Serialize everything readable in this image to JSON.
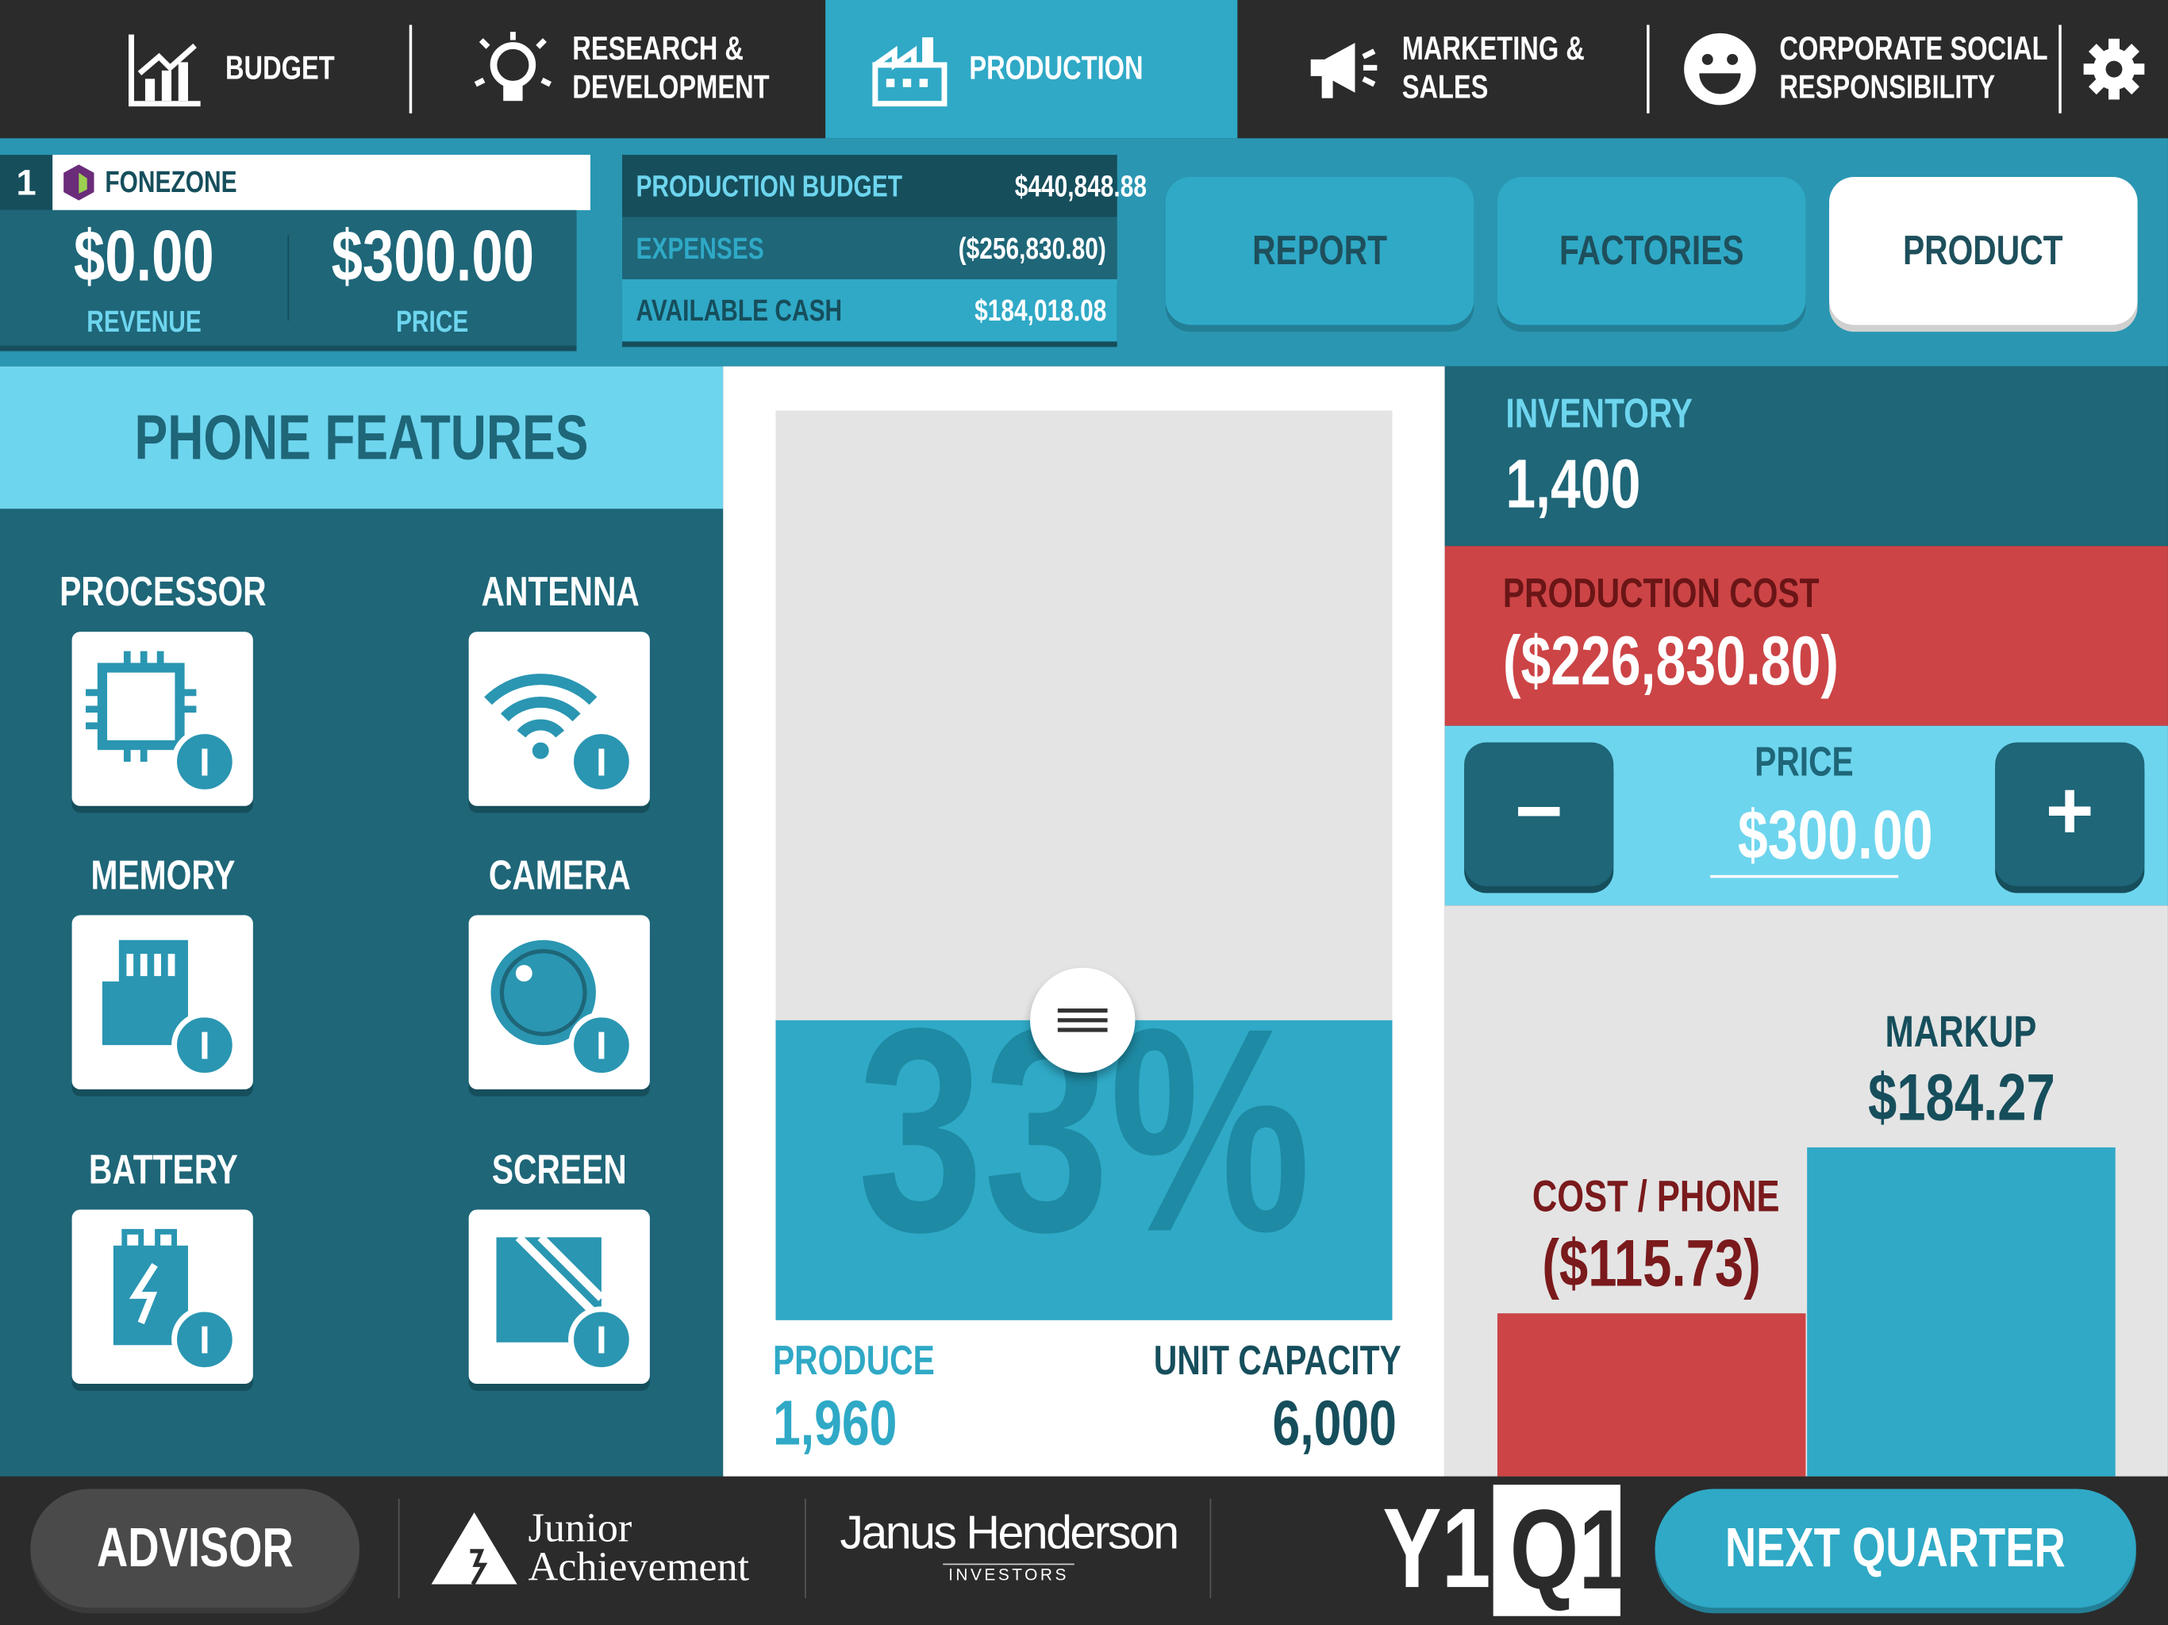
{
  "nav": {
    "tabs": [
      {
        "label_1": "BUDGET",
        "label_2": "",
        "icon": "chart-growth-icon"
      },
      {
        "label_1": "RESEARCH &",
        "label_2": "DEVELOPMENT",
        "icon": "lightbulb-icon"
      },
      {
        "label_1": "PRODUCTION",
        "label_2": "",
        "icon": "factory-icon",
        "active": true
      },
      {
        "label_1": "MARKETING &",
        "label_2": "SALES",
        "icon": "megaphone-icon"
      },
      {
        "label_1": "CORPORATE SOCIAL",
        "label_2": "RESPONSIBILITY",
        "icon": "smiley-icon"
      }
    ],
    "settings_icon": "gear-icon"
  },
  "company": {
    "rank": "1",
    "name": "FONEZONE",
    "revenue": "$0.00",
    "revenue_label": "REVENUE",
    "price": "$300.00",
    "price_label": "PRICE"
  },
  "budget": {
    "rows": [
      {
        "label": "PRODUCTION BUDGET",
        "value": "$440,848.88"
      },
      {
        "label": "EXPENSES",
        "value": "($256,830.80)"
      },
      {
        "label": "AVAILABLE CASH",
        "value": "$184,018.08"
      }
    ]
  },
  "views": {
    "report": "REPORT",
    "factories": "FACTORIES",
    "product": "PRODUCT",
    "selected": "PRODUCT"
  },
  "features": {
    "title": "PHONE FEATURES",
    "items": [
      {
        "label": "PROCESSOR",
        "icon": "processor-chip-icon",
        "level": "I"
      },
      {
        "label": "ANTENNA",
        "icon": "wifi-antenna-icon",
        "level": "I"
      },
      {
        "label": "MEMORY",
        "icon": "memory-card-icon",
        "level": "I"
      },
      {
        "label": "CAMERA",
        "icon": "camera-lens-icon",
        "level": "I"
      },
      {
        "label": "BATTERY",
        "icon": "battery-icon",
        "level": "I"
      },
      {
        "label": "SCREEN",
        "icon": "screen-icon",
        "level": "I"
      }
    ]
  },
  "production": {
    "percent": "33%",
    "fill_fraction": 0.33,
    "produce_label": "PRODUCE",
    "produce": "1,960",
    "capacity_label": "UNIT CAPACITY",
    "capacity": "6,000"
  },
  "inventory": {
    "label": "INVENTORY",
    "value": "1,400"
  },
  "production_cost": {
    "label": "PRODUCTION COST",
    "value": "($226,830.80)"
  },
  "price": {
    "label": "PRICE",
    "value": "$300.00",
    "minus": "−",
    "plus": "+"
  },
  "breakdown": {
    "cost_label": "COST / PHONE",
    "cost": "($115.73)",
    "markup_label": "MARKUP",
    "markup": "$184.27",
    "colors": {
      "cost": "#cc4446",
      "markup": "#2fa9c6"
    }
  },
  "footer": {
    "advisor": "ADVISOR",
    "ja_1": "Junior",
    "ja_2": "Achievement",
    "jh_1": "Janus Henderson",
    "jh_2": "INVESTORS",
    "year": "Y1",
    "quarter": "Q1",
    "next": "NEXT QUARTER"
  }
}
